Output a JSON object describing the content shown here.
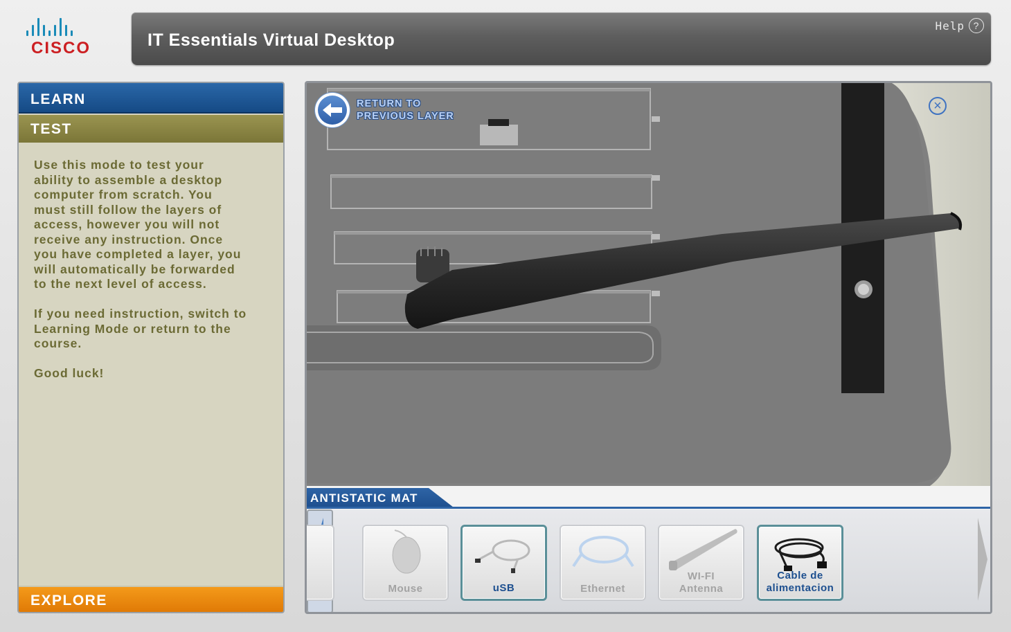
{
  "brand": {
    "logo_text": "CISCO",
    "brand_color": "#cc1f22",
    "bars_color": "#1a8bb8"
  },
  "header": {
    "title": "IT Essentials Virtual Desktop",
    "help_label": "Help",
    "help_icon": "?"
  },
  "sidebar": {
    "learn_label": "LEARN",
    "test_label": "TEST",
    "explore_label": "EXPLORE",
    "description": "Use this mode to test your\nability to assemble a desktop\ncomputer from scratch. You\nmust still follow the layers of\naccess, however you will not\nreceive any instruction. Once\nyou have completed a layer, you\nwill automatically be forwarded\nto the next level of access.\n\nIf you need instruction, switch to\nLearning Mode or return to the\ncourse.\n\nGood luck!"
  },
  "viewport": {
    "return_label": "RETURN TO\nPREVIOUS LAYER",
    "close_icon": "×",
    "mat_label": "ANTISTATIC MAT"
  },
  "tray": {
    "items": [
      {
        "label": "Mouse",
        "icon": "mouse-icon",
        "active": false
      },
      {
        "label": "uSB",
        "icon": "usb-cable-icon",
        "active": true
      },
      {
        "label": "Ethernet",
        "icon": "ethernet-cable-icon",
        "active": false
      },
      {
        "label": "WI-FI\nAntenna",
        "icon": "antenna-icon",
        "active": false
      },
      {
        "label": "Cable de\nalimentacion",
        "icon": "power-cable-icon",
        "active": true
      }
    ]
  },
  "colors": {
    "learn": "#1d5898",
    "test": "#8a8444",
    "explore": "#ee8a10",
    "accent_blue": "#2e64a6"
  }
}
